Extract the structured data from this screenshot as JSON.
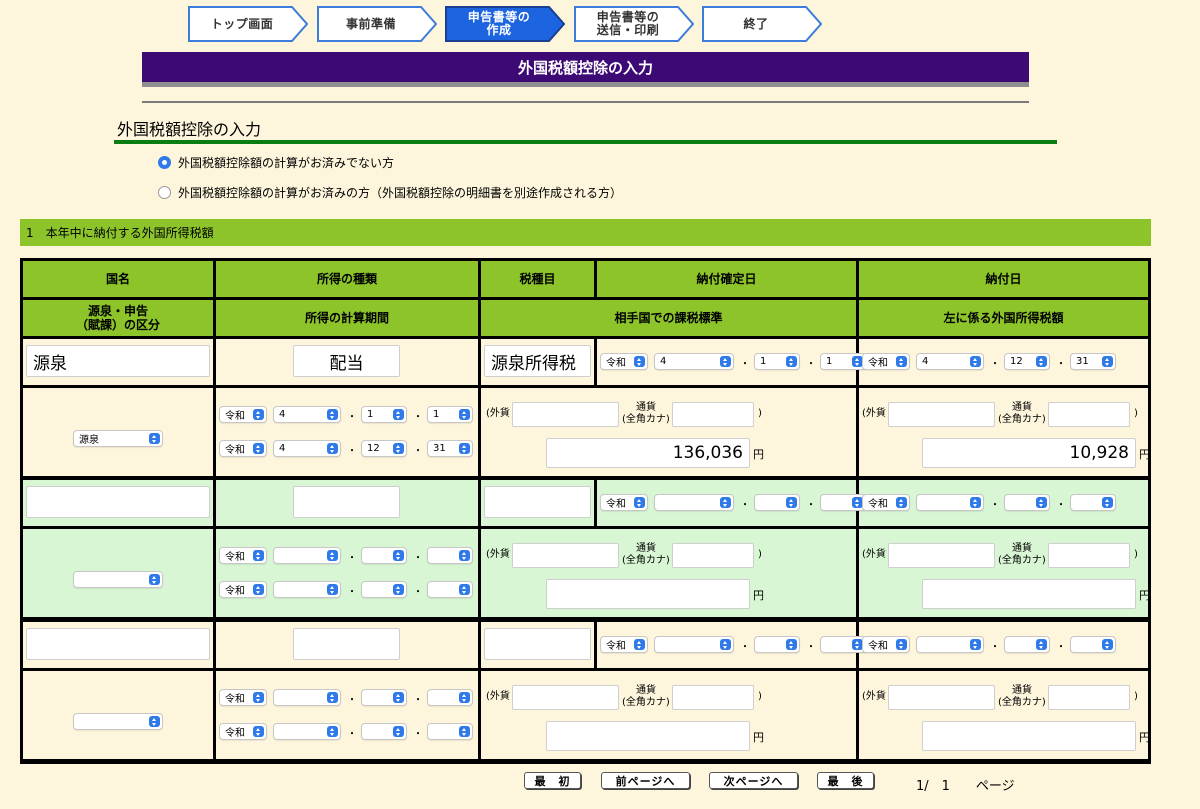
{
  "steps": [
    {
      "label": "トップ画面",
      "line2": "",
      "active": false
    },
    {
      "label": "事前準備",
      "line2": "",
      "active": false
    },
    {
      "label": "申告書等の",
      "line2": "作成",
      "active": true
    },
    {
      "label": "申告書等の",
      "line2": "送信・印刷",
      "active": false
    },
    {
      "label": "終了",
      "line2": "",
      "active": false
    }
  ],
  "banner_title": "外国税額控除の入力",
  "section_title": "外国税額控除の入力",
  "radio_options": [
    {
      "label": "外国税額控除額の計算がお済みでない方",
      "checked": true
    },
    {
      "label": "外国税額控除額の計算がお済みの方（外国税額控除の明細書を別途作成される方）",
      "checked": false
    }
  ],
  "subsection_title": "1　本年中に納付する外国所得税額",
  "headers": {
    "country": "国名",
    "income_type": "所得の種類",
    "tax_item": "税種目",
    "payment_fixed_date": "納付確定日",
    "payment_date": "納付日",
    "withholding_type_l1": "源泉・申告",
    "withholding_type_l2": "（賦課）の区分",
    "income_calc_period": "所得の計算期間",
    "foreign_tax_base": "相手国での課税標準",
    "foreign_income_tax": "左に係る外国所得税額"
  },
  "labels": {
    "era": "令和",
    "foreign_currency": "(外貨",
    "currency_l1": "通貨",
    "currency_l2": "(全角カナ)",
    "close_paren": ")",
    "yen": "円",
    "dot": "・"
  },
  "entries": [
    {
      "country": "源泉",
      "income_type": "配当",
      "tax_item": "源泉所得税",
      "fixed_date": {
        "y": "4",
        "m": "1",
        "d": "1"
      },
      "pay_date": {
        "y": "4",
        "m": "12",
        "d": "31"
      },
      "withholding_type": "源泉",
      "period_start": {
        "y": "4",
        "m": "1",
        "d": "1"
      },
      "period_end": {
        "y": "4",
        "m": "12",
        "d": "31"
      },
      "tax_base": "136,036",
      "foreign_tax": "10,928"
    },
    {
      "country": "",
      "income_type": "",
      "tax_item": "",
      "fixed_date": {
        "y": "",
        "m": "",
        "d": ""
      },
      "pay_date": {
        "y": "",
        "m": "",
        "d": ""
      },
      "withholding_type": "",
      "period_start": {
        "y": "",
        "m": "",
        "d": ""
      },
      "period_end": {
        "y": "",
        "m": "",
        "d": ""
      },
      "tax_base": "",
      "foreign_tax": ""
    },
    {
      "country": "",
      "income_type": "",
      "tax_item": "",
      "fixed_date": {
        "y": "",
        "m": "",
        "d": ""
      },
      "pay_date": {
        "y": "",
        "m": "",
        "d": ""
      },
      "withholding_type": "",
      "period_start": {
        "y": "",
        "m": "",
        "d": ""
      },
      "period_end": {
        "y": "",
        "m": "",
        "d": ""
      },
      "tax_base": "",
      "foreign_tax": ""
    }
  ],
  "pager": {
    "first": "最　初",
    "prev": "前ページへ",
    "next": "次ページへ",
    "last": "最　後",
    "info": "1/　1　　ページ"
  }
}
